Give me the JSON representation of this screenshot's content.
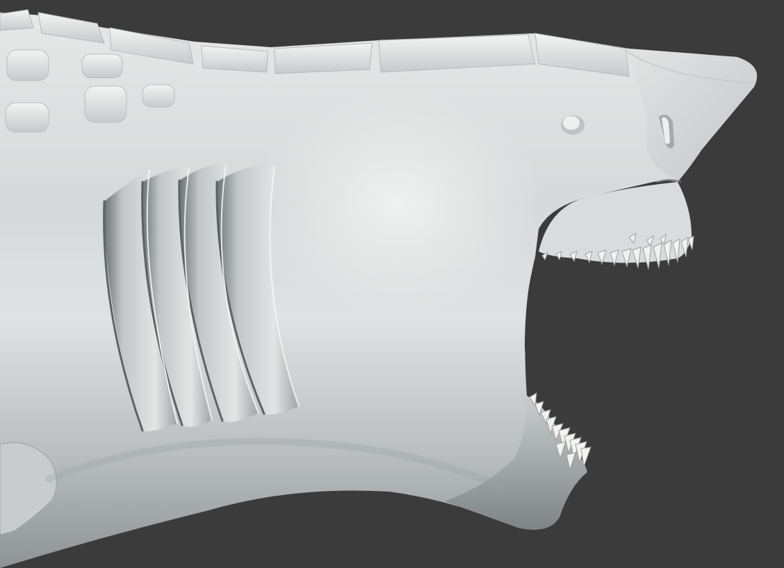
{
  "scene": {
    "subject": "shark-sculpt",
    "colors": {
      "background": "#3b3b3b",
      "mouth_interior": "#3a3a3a",
      "skin_light": "#eaecec",
      "skin_mid": "#cfd2d2",
      "skin_shadow": "#8f9393",
      "tooth": "#f2f2f0"
    }
  }
}
